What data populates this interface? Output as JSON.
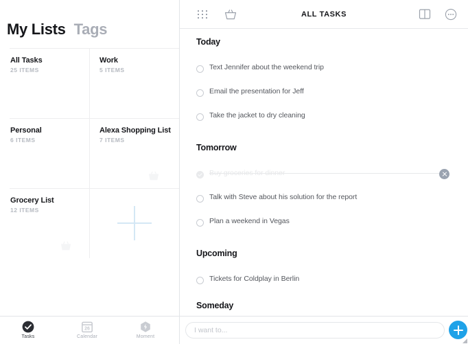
{
  "sidebar": {
    "tabs": [
      {
        "label": "My Lists",
        "active": true
      },
      {
        "label": "Tags",
        "active": false
      }
    ],
    "lists": [
      {
        "title": "All Tasks",
        "count": "25 ITEMS",
        "col": 0,
        "row": 0,
        "basket": false
      },
      {
        "title": "Work",
        "count": "5 ITEMS",
        "col": 1,
        "row": 0,
        "basket": false
      },
      {
        "title": "Personal",
        "count": "6 ITEMS",
        "col": 0,
        "row": 1,
        "basket": false
      },
      {
        "title": "Alexa Shopping List",
        "count": "7 ITEMS",
        "col": 1,
        "row": 1,
        "basket": true
      },
      {
        "title": "Grocery List",
        "count": "12 ITEMS",
        "col": 0,
        "row": 2,
        "basket": true
      }
    ],
    "add_list": {
      "icon": "plus-icon"
    }
  },
  "toolbar": {
    "title": "ALL TASKS",
    "left_buttons": [
      {
        "name": "grid-view-icon"
      },
      {
        "name": "basket-icon"
      }
    ],
    "right_buttons": [
      {
        "name": "split-view-icon"
      },
      {
        "name": "more-options-icon"
      }
    ]
  },
  "tasklist": {
    "sections": [
      {
        "title": "Today",
        "tasks": [
          {
            "text": "Text Jennifer about the weekend trip",
            "done": false
          },
          {
            "text": "Email the presentation for Jeff",
            "done": false
          },
          {
            "text": "Take the jacket to dry cleaning",
            "done": false
          }
        ]
      },
      {
        "title": "Tomorrow",
        "tasks": [
          {
            "text": "Buy groceries for dinner",
            "done": true
          },
          {
            "text": "Talk with Steve about his solution for the report",
            "done": false
          },
          {
            "text": "Plan a weekend in Vegas",
            "done": false
          }
        ]
      },
      {
        "title": "Upcoming",
        "tasks": [
          {
            "text": "Tickets for Coldplay in Berlin",
            "done": false
          }
        ]
      },
      {
        "title": "Someday",
        "tasks": []
      }
    ]
  },
  "tabbar": {
    "items": [
      {
        "label": "Tasks",
        "icon": "check-circle-icon",
        "active": true
      },
      {
        "label": "Calendar",
        "icon": "calendar-icon",
        "badge": "26",
        "active": false
      },
      {
        "label": "Moment",
        "icon": "moment-hexagon-icon",
        "active": false
      }
    ]
  },
  "composer": {
    "placeholder": "I want to...",
    "value": "",
    "add_button": "add-icon"
  },
  "colors": {
    "accent_blue": "#1fa2e8",
    "text_dark": "#15161a",
    "text_muted": "#a9adb6",
    "divider": "#e2e4e7",
    "done_gray": "#e7e8ea"
  }
}
